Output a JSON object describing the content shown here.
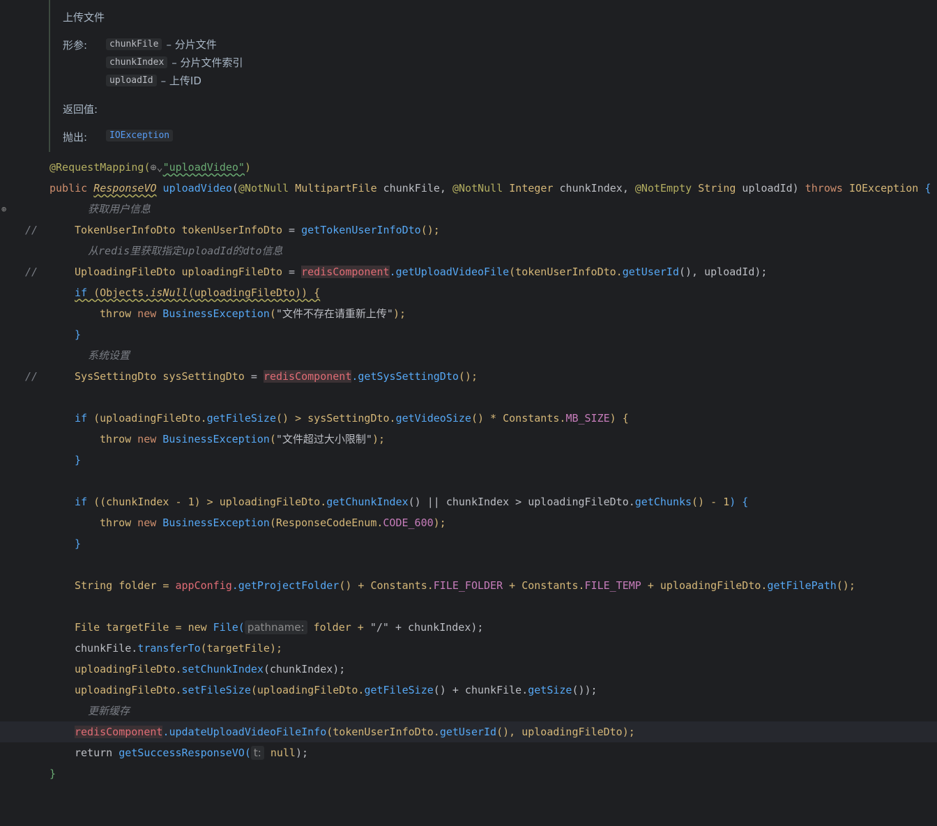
{
  "doc": {
    "title": "上传文件",
    "params_label": "形参:",
    "params": [
      {
        "name": "chunkFile",
        "desc": "– 分片文件"
      },
      {
        "name": "chunkIndex",
        "desc": "– 分片文件索引"
      },
      {
        "name": "uploadId",
        "desc": "– 上传ID"
      }
    ],
    "return_label": "返回值:",
    "throws_label": "抛出:",
    "throws_value": "IOException"
  },
  "code": {
    "annotation": "@RequestMapping(",
    "mapping_value": "\"uploadVideo\"",
    "mapping_close": ")",
    "sig_public": "public ",
    "sig_type": "ResponseVO",
    "sig_name": " uploadVideo",
    "sig_params_1": "(",
    "sig_ann1": "@NotNull",
    "sig_t1": " MultipartFile",
    "sig_v1": " chunkFile, ",
    "sig_ann2": "@NotNull",
    "sig_t2": " Integer",
    "sig_v2": " chunkIndex, ",
    "sig_ann3": "@NotEmpty",
    "sig_t3": " String",
    "sig_v3": " uploadId)",
    "sig_throws": " throws",
    "sig_exc": " IOException ",
    "sig_open": "{",
    "comment1": "获取用户信息",
    "comment2": "从redis里获取指定uploadId的dto信息",
    "comment3": "系统设置",
    "comment4": "更新缓存",
    "slash": "//",
    "l_token_type": "TokenUserInfoDto",
    "l_token_var": " tokenUserInfoDto",
    "l_token_eq": " = ",
    "l_token_call": "getTokenUserInfoDto",
    "l_token_end": "();",
    "l_up_type": "UploadingFileDto",
    "l_up_var": " uploadingFileDto",
    "l_up_eq": " = ",
    "redis": "redisComponent",
    "l_up_call": ".getUploadVideoFile",
    "l_up_args_a": "(tokenUserInfoDto.",
    "l_up_getuid": "getUserId",
    "l_up_args_b": "(), uploadId);",
    "if_null_kw": "if",
    "if_null_rest": " (Objects.",
    "is_null": "isNull",
    "if_null_end": "(uploadingFileDto)) {",
    "throw_kw": "throw",
    "new_kw": " new",
    "biz_exc": " BusinessException",
    "msg1": "\"文件不存在请重新上传\"",
    "end_paren": ");",
    "close_brace": "}",
    "sys_type": "SysSettingDto",
    "sys_var": " sysSettingDto",
    "sys_eq": " = ",
    "sys_call": ".getSysSettingDto",
    "sys_end": "();",
    "if2_a": "(uploadingFileDto.",
    "getFileSize": "getFileSize",
    "if2_b": "() > sysSettingDto.",
    "getVideoSize": "getVideoSize",
    "if2_c": "() * Constants.",
    "mb_size": "MB_SIZE",
    "if2_d": ") {",
    "msg2": "\"文件超过大小限制\"",
    "if3_a": "((chunkIndex - ",
    "one": "1",
    "if3_b": ") > uploadingFileDto.",
    "getChunkIndex": "getChunkIndex",
    "if3_c": "() || chunkIndex > uploadingFileDto.",
    "getChunks": "getChunks",
    "if3_d": "() - ",
    "if3_e": ") {",
    "resp_code": "(ResponseCodeEnum.",
    "code600": "CODE_600",
    "folder_type": "String",
    "folder_var": " folder = ",
    "appConfig": "appConfig",
    "getProjectFolder": ".getProjectFolder",
    "folder_b": "() + Constants.",
    "file_folder": "FILE_FOLDER",
    "folder_c": " + Constants.",
    "file_temp": "FILE_TEMP",
    "folder_d": " + uploadingFileDto.",
    "getFilePath": "getFilePath",
    "folder_e": "();",
    "file_type": "File",
    "file_var": " targetFile = ",
    "file_new": "new",
    "file_ctor": " File(",
    "hint_pathname": "pathname:",
    "file_args": " folder + ",
    "slash_str": "\"/\"",
    "file_end": " + chunkIndex);",
    "transfer_a": "chunkFile.",
    "transferTo": "transferTo",
    "transfer_b": "(targetFile);",
    "setchunk_a": "uploadingFileDto.",
    "setChunkIndex": "setChunkIndex",
    "setchunk_b": "(chunkIndex);",
    "setsize_a": "uploadingFileDto.",
    "setFileSize": "setFileSize",
    "setsize_b": "(uploadingFileDto.",
    "setsize_c": "() + chunkFile.",
    "getSize": "getSize",
    "setsize_d": "());",
    "update_call": ".updateUploadVideoFileInfo",
    "update_a": "(tokenUserInfoDto.",
    "update_b": "(), uploadingFileDto);",
    "return_kw": "return",
    "return_call": " getSuccessResponseVO(",
    "hint_t": "t:",
    "return_null": " null",
    "return_end": ");"
  }
}
